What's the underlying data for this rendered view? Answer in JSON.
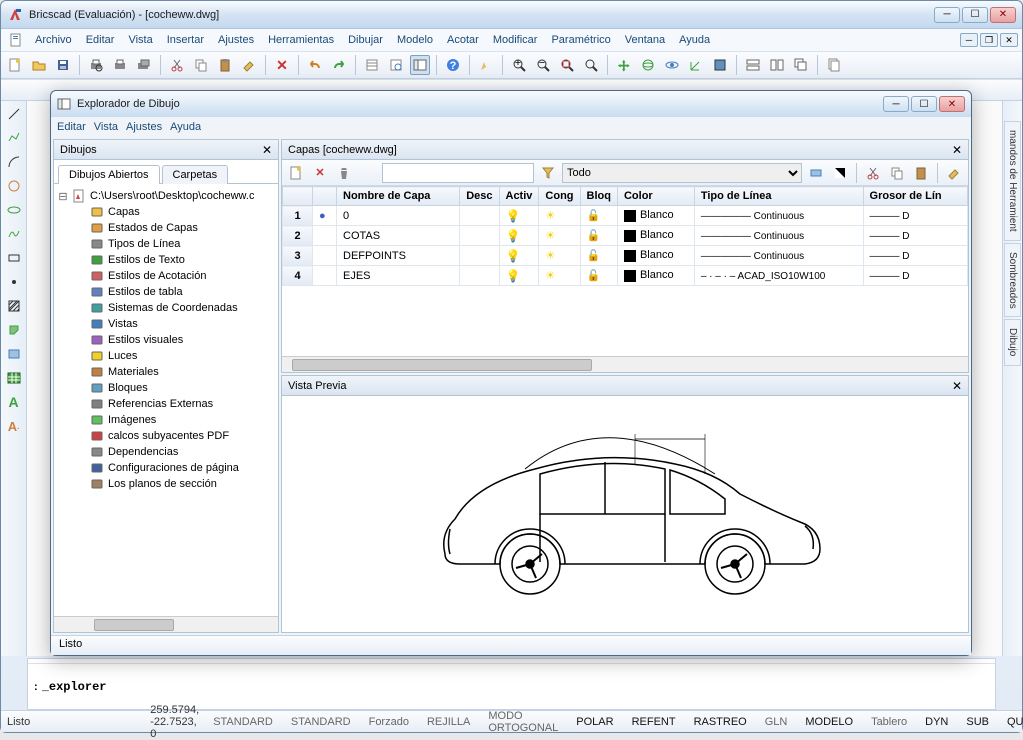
{
  "app": {
    "title": "Bricscad (Evaluación) - [cocheww.dwg]"
  },
  "menubar": [
    "Archivo",
    "Editar",
    "Vista",
    "Insertar",
    "Ajustes",
    "Herramientas",
    "Dibujar",
    "Modelo",
    "Acotar",
    "Modificar",
    "Paramétrico",
    "Ventana",
    "Ayuda"
  ],
  "command": {
    "history": "",
    "prompt": ":",
    "value": "_explorer"
  },
  "status": {
    "ready": "Listo",
    "coords": "259.5794, -22.7523, 0",
    "std1": "STANDARD",
    "std2": "STANDARD",
    "items": [
      "Forzado",
      "REJILLA",
      "MODO ORTOGONAL",
      "POLAR",
      "REFENT",
      "RASTREO",
      "GLN",
      "MODELO",
      "Tablero",
      "DYN",
      "SUB",
      "QUAD"
    ]
  },
  "right_tabs": [
    "mandos de Herramient",
    "Sombreados",
    "Dibujo"
  ],
  "explorer": {
    "title": "Explorador de Dibujo",
    "menus": [
      "Editar",
      "Vista",
      "Ajustes",
      "Ayuda"
    ],
    "left_panel_title": "Dibujos",
    "tabs": [
      "Dibujos Abiertos",
      "Carpetas"
    ],
    "active_tab": 0,
    "tree_root": "C:\\Users\\root\\Desktop\\cocheww.c",
    "tree_items": [
      "Capas",
      "Estados de Capas",
      "Tipos de Línea",
      "Estilos de Texto",
      "Estilos de Acotación",
      "Estilos de tabla",
      "Sistemas de Coordenadas",
      "Vistas",
      "Estilos visuales",
      "Luces",
      "Materiales",
      "Bloques",
      "Referencias Externas",
      "Imágenes",
      "calcos subyacentes PDF",
      "Dependencias",
      "Configuraciones de página",
      "Los planos de sección"
    ],
    "layers_title": "Capas [cocheww.dwg]",
    "filter_value": "Todo",
    "columns": [
      "",
      "",
      "Nombre de Capa",
      "Desc",
      "Activ",
      "Cong",
      "Bloq",
      "Color",
      "Tipo de Línea",
      "Grosor de Lín"
    ],
    "rows": [
      {
        "n": "1",
        "current": true,
        "name": "0",
        "on": true,
        "frz": false,
        "lck": false,
        "color": "Blanco",
        "ltype": "Continuous",
        "ldash": "—————",
        "lw": "D"
      },
      {
        "n": "2",
        "current": false,
        "name": "COTAS",
        "on": true,
        "frz": false,
        "lck": false,
        "color": "Blanco",
        "ltype": "Continuous",
        "ldash": "—————",
        "lw": "D"
      },
      {
        "n": "3",
        "current": false,
        "name": "DEFPOINTS",
        "on": true,
        "frz": false,
        "lck": false,
        "color": "Blanco",
        "ltype": "Continuous",
        "ldash": "—————",
        "lw": "D"
      },
      {
        "n": "4",
        "current": false,
        "name": "EJES",
        "on": true,
        "frz": false,
        "lck": false,
        "color": "Blanco",
        "ltype": "ACAD_ISO10W100",
        "ldash": "– · – · –",
        "lw": "D"
      }
    ],
    "preview_title": "Vista Previa",
    "status": "Listo"
  }
}
